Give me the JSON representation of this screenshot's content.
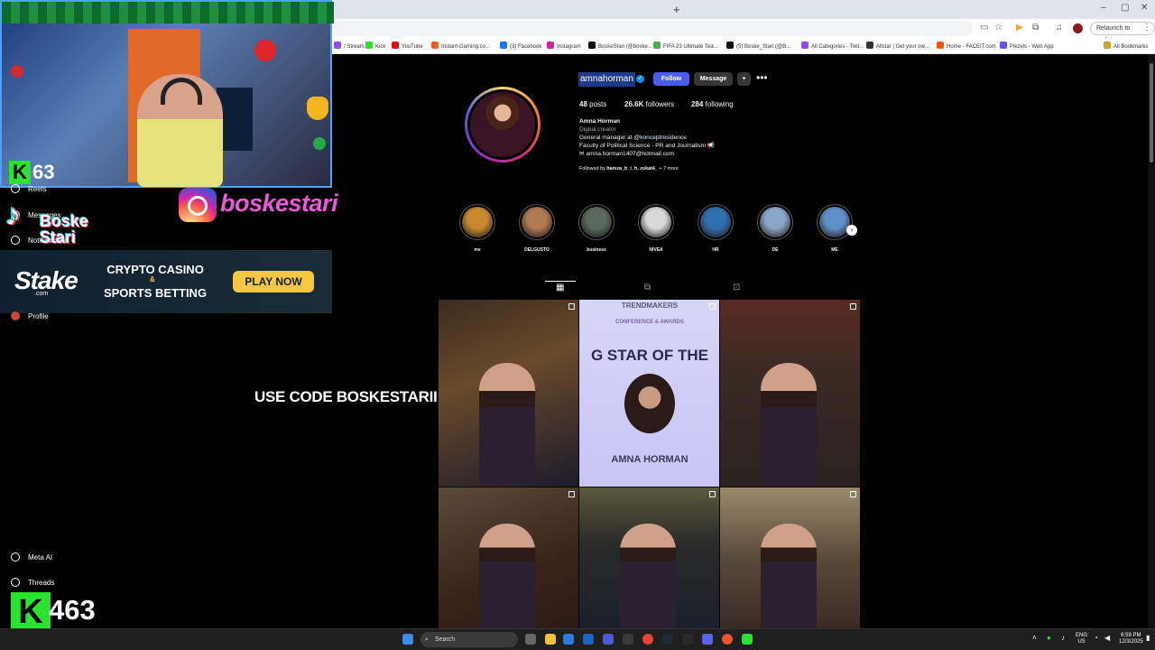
{
  "browser": {
    "new_tab_icon": "+",
    "window_controls": [
      "–",
      "▢",
      "✕"
    ],
    "relaunch_label": "Relaunch to update",
    "all_bookmarks": "All Bookmarks",
    "bookmarks": [
      {
        "label": "/ Stream...",
        "color": "#9146ff"
      },
      {
        "label": "Kick",
        "color": "#29e32e"
      },
      {
        "label": "YouTube",
        "color": "#ff0000"
      },
      {
        "label": "Instant-Gaming.co...",
        "color": "#ff5a1f"
      },
      {
        "label": "(3) Facebook",
        "color": "#1877f2"
      },
      {
        "label": "Instagram",
        "color": "#d6249f"
      },
      {
        "label": "BoskeStari (@boske...",
        "color": "#111111"
      },
      {
        "label": "FIFA 23 Ultimate Tea...",
        "color": "#4caf50"
      },
      {
        "label": "(5) Boske_Stari (@B...",
        "color": "#111111"
      },
      {
        "label": "All Categories - Twit...",
        "color": "#9146ff"
      },
      {
        "label": "Allstar | Get your ow...",
        "color": "#333333"
      },
      {
        "label": "Home - FACEIT.com",
        "color": "#ff5500"
      },
      {
        "label": "Pikzels - Web App",
        "color": "#6a4cff"
      }
    ]
  },
  "profile": {
    "username": "amnahorman",
    "follow_label": "Follow",
    "message_label": "Message",
    "suggest_icon": "+",
    "more_icon": "•••",
    "posts_count": "48",
    "posts_label": "posts",
    "followers_count": "26.6K",
    "followers_label": "followers",
    "following_count": "284",
    "following_label": "following",
    "full_name": "Amna Horman",
    "category": "Digital creator",
    "bio_line1_prefix": "General manager at ",
    "bio_line1_link": "@konceptresidence",
    "bio_line2": "Faculty of Political Science - PR and Journalism",
    "email": "amna.horman1407@hotmail.com",
    "followed_by_prefix": "Followed by ",
    "followed_by_names": "hamza_b_i_h, zukat4_",
    "followed_by_more": " + 7 more"
  },
  "highlights": [
    {
      "label": "me",
      "color": "#c98a2e"
    },
    {
      "label": "DELGUSTO",
      "color": "#b07a52"
    },
    {
      "label": "business",
      "color": "#5a6a5a"
    },
    {
      "label": "NIVEA",
      "color": "#d8d8d8"
    },
    {
      "label": "HR",
      "color": "#2f6fb0"
    },
    {
      "label": "DE",
      "color": "#8aa6c8"
    },
    {
      "label": "ME",
      "color": "#5f8fc8"
    }
  ],
  "tabs": {
    "posts_icon": "▦",
    "reels_icon": "⧉",
    "tagged_icon": "⊡"
  },
  "posts": [
    {
      "bg": "linear-gradient(160deg,#3b2c1e,#6a4a2a 40%,#1b1b2a)"
    },
    {
      "bg": "linear-gradient(#d7d6f8,#c8c4f5)",
      "text_top": "TRENDMAKERS",
      "text_mid": "CONFERENCE & AWARDS",
      "text_star": "G STAR OF THE",
      "text_name": "AMNA HORMAN"
    },
    {
      "bg": "linear-gradient(#5a2a22,#3a2a22 40%,#2a2220)"
    },
    {
      "bg": "linear-gradient(160deg,#5a4a38,#3a2418 60%,#2a1a14)"
    },
    {
      "bg": "linear-gradient(#5a5a3a,#2a2a2a 40%,#1a1f2a)"
    },
    {
      "bg": "linear-gradient(#9a8a6a,#5a4a3a 50%,#3a2a22)"
    }
  ],
  "overlay": {
    "kick_top_count": "63",
    "instagram_handle": "boskestari",
    "tiktok_line1": "Boske",
    "tiktok_line2": "Stari",
    "stake_logo": "Stake",
    "stake_sub": ".com",
    "stake_line1": "CRYPTO CASINO",
    "stake_amp": "&",
    "stake_line2": "SPORTS BETTING",
    "stake_cta": "PLAY NOW",
    "code_text": "USE CODE BOSKESTARII",
    "sidebar": [
      {
        "label": "Reels"
      },
      {
        "label": "Messages"
      },
      {
        "label": "Notifications"
      },
      {
        "label": "Profile"
      },
      {
        "label": "Meta AI"
      },
      {
        "label": "Threads"
      }
    ],
    "viewer_count": "463",
    "viewer_letter": "K",
    "channel_name": "boskestari"
  },
  "taskbar": {
    "search_label": "Search",
    "lang_top": "ENG",
    "lang_bottom": "US",
    "time": "6:59 PM",
    "date": "12/3/2025"
  }
}
